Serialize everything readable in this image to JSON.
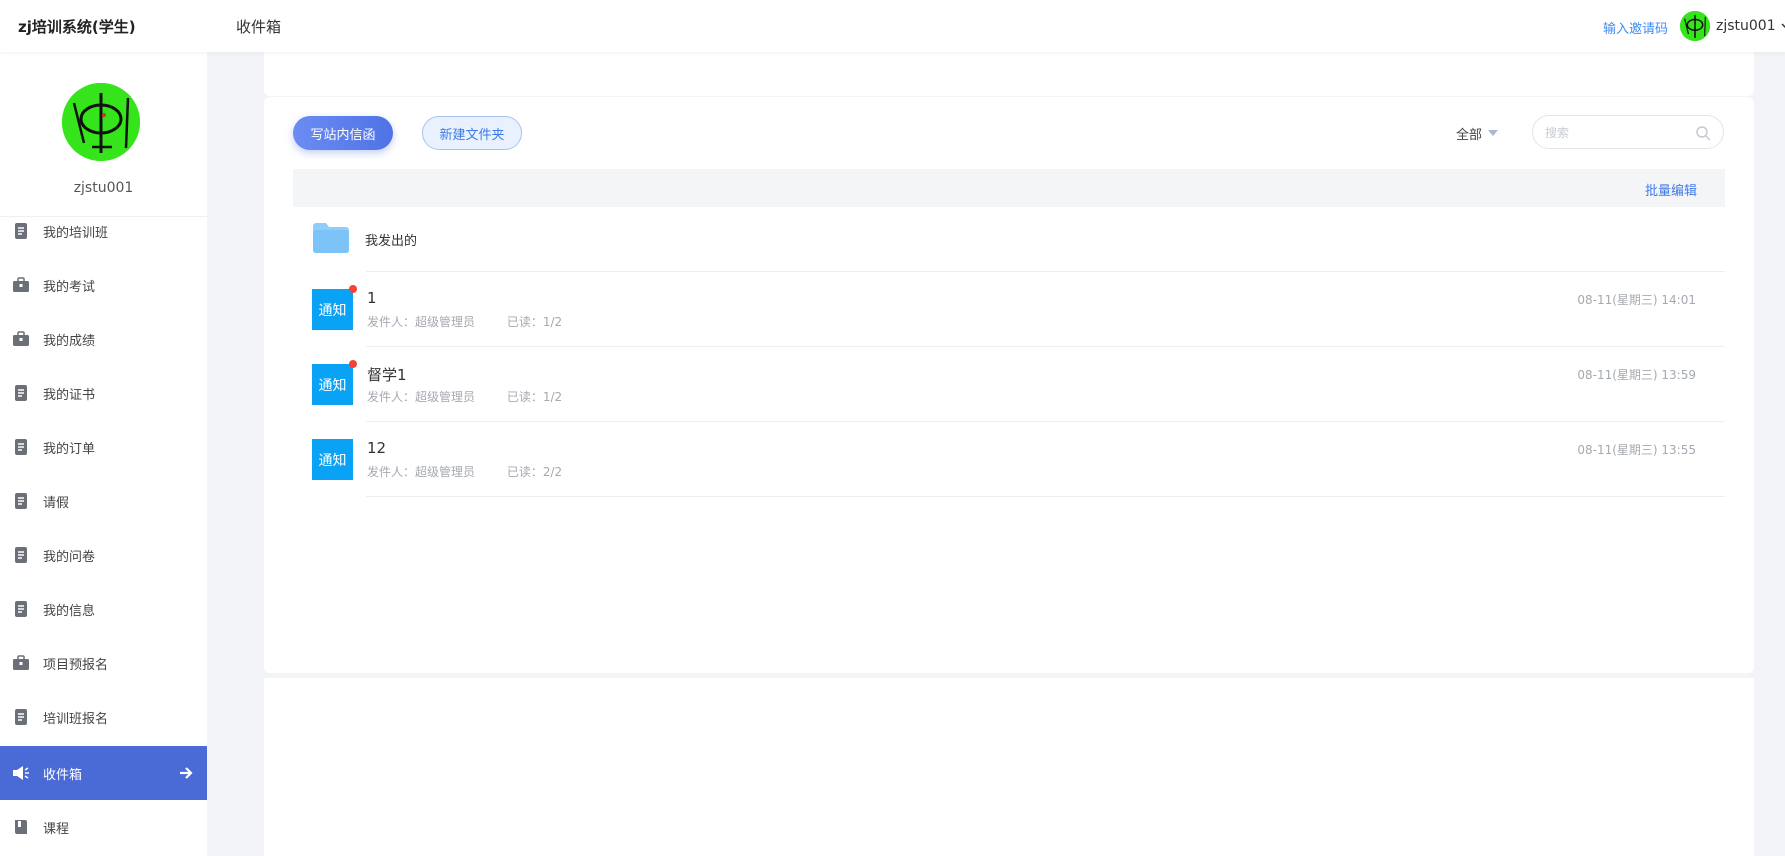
{
  "header": {
    "app_title": "zj培训系统(学生)",
    "page_title": "收件箱",
    "invite_link": "输入邀请码",
    "username": "zjstu001"
  },
  "sidebar": {
    "profile_name": "zjstu001",
    "items": [
      {
        "label": "我的培训班",
        "icon": "document-icon"
      },
      {
        "label": "我的考试",
        "icon": "briefcase-icon"
      },
      {
        "label": "我的成绩",
        "icon": "briefcase-icon"
      },
      {
        "label": "我的证书",
        "icon": "document-icon"
      },
      {
        "label": "我的订单",
        "icon": "document-icon"
      },
      {
        "label": "请假",
        "icon": "document-icon"
      },
      {
        "label": "我的问卷",
        "icon": "document-icon"
      },
      {
        "label": "我的信息",
        "icon": "document-icon"
      },
      {
        "label": "项目预报名",
        "icon": "briefcase-icon"
      },
      {
        "label": "培训班报名",
        "icon": "document-icon"
      },
      {
        "label": "收件箱",
        "icon": "megaphone-icon",
        "active": true
      },
      {
        "label": "课程",
        "icon": "book-icon"
      }
    ]
  },
  "toolbar": {
    "compose_label": "写站内信函",
    "new_folder_label": "新建文件夹",
    "filter_label": "全部",
    "search_placeholder": "搜索"
  },
  "list": {
    "batch_edit_label": "批量编辑",
    "folder_label": "我发出的",
    "messages": [
      {
        "badge": "通知",
        "title": "1",
        "sender": "发件人：超级管理员",
        "read": "已读：1/2",
        "time": "08-11(星期三) 14:01",
        "unread": true
      },
      {
        "badge": "通知",
        "title": "督学1",
        "sender": "发件人：超级管理员",
        "read": "已读：1/2",
        "time": "08-11(星期三) 13:59",
        "unread": true
      },
      {
        "badge": "通知",
        "title": "12",
        "sender": "发件人：超级管理员",
        "read": "已读：2/2",
        "time": "08-11(星期三) 13:55",
        "unread": false
      }
    ]
  },
  "colors": {
    "accent": "#4a6ad6",
    "link": "#3f7be6",
    "notice": "#0aa2f5",
    "unread_dot": "#f44336",
    "avatar_green": "#35e41b"
  }
}
